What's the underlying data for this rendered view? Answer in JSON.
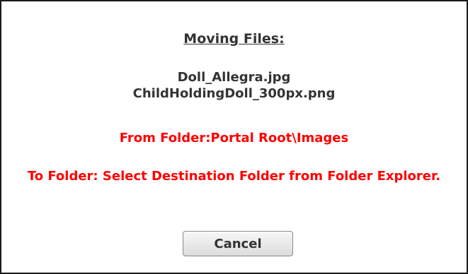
{
  "dialog": {
    "heading": "Moving Files:",
    "files": [
      "Doll_Allegra.jpg",
      "ChildHoldingDoll_300px.png"
    ],
    "from_folder": "From Folder:Portal Root\\Images",
    "to_folder": "To Folder: Select Destination Folder from Folder Explorer.",
    "cancel_label": "Cancel"
  },
  "colors": {
    "text": "#333333",
    "warning": "#ff0000",
    "border": "#1a1a1a"
  }
}
